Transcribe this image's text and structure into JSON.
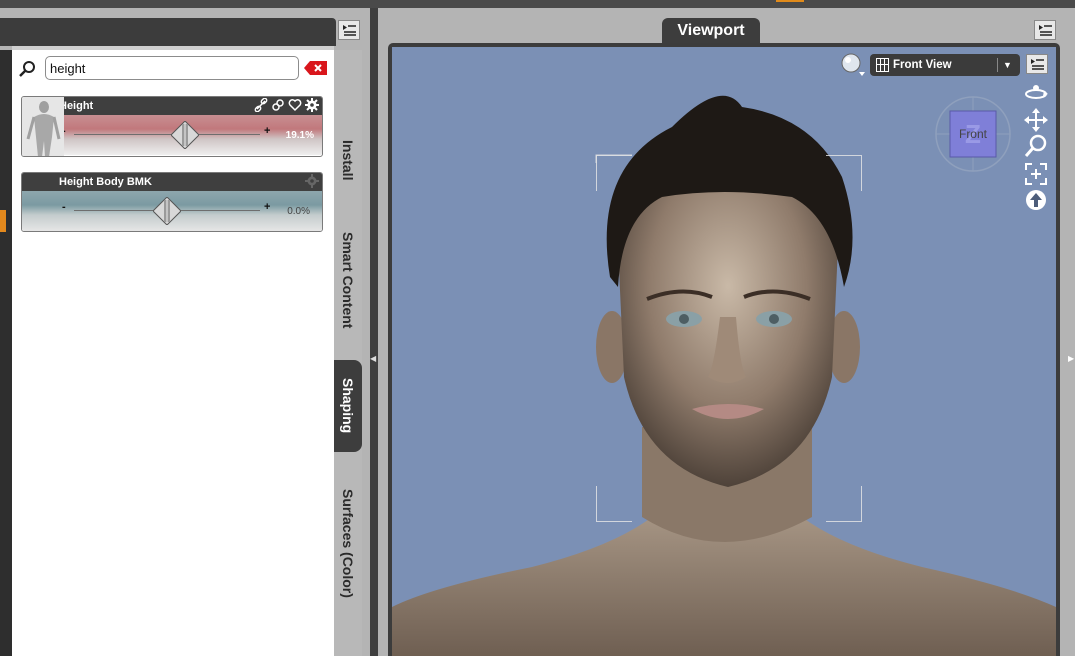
{
  "search": {
    "value": "height"
  },
  "properties": [
    {
      "label": "Height",
      "value_text": "19.1%",
      "value": 19.1
    },
    {
      "label": "Height Body BMK",
      "value_text": "0.0%",
      "value": 0.0
    }
  ],
  "slider_signs": {
    "minus": "-",
    "plus": "+"
  },
  "side_tabs": {
    "install": "Install",
    "smart_content": "Smart Content",
    "shaping": "Shaping",
    "surfaces": "Surfaces (Color)"
  },
  "viewport": {
    "tab_label": "Viewport",
    "view_select": "Front View",
    "cube_label": "Front",
    "cube_letter": "Z"
  },
  "icons": {
    "search": "search-icon",
    "clear": "clear-x-icon",
    "link": "link-icon",
    "favorite": "heart-icon",
    "settings": "gear-icon",
    "menu": "panel-menu-icon",
    "orbit": "orbit-icon",
    "pan": "pan-arrows-icon",
    "zoom": "zoom-icon",
    "frame": "frame-icon",
    "reset": "reset-up-arrow-icon"
  },
  "colors": {
    "viewport_bg": "#7b90b5",
    "accent": "#e3891d",
    "active_tab": "#3d3d3d",
    "clear_red": "#d9161c"
  }
}
